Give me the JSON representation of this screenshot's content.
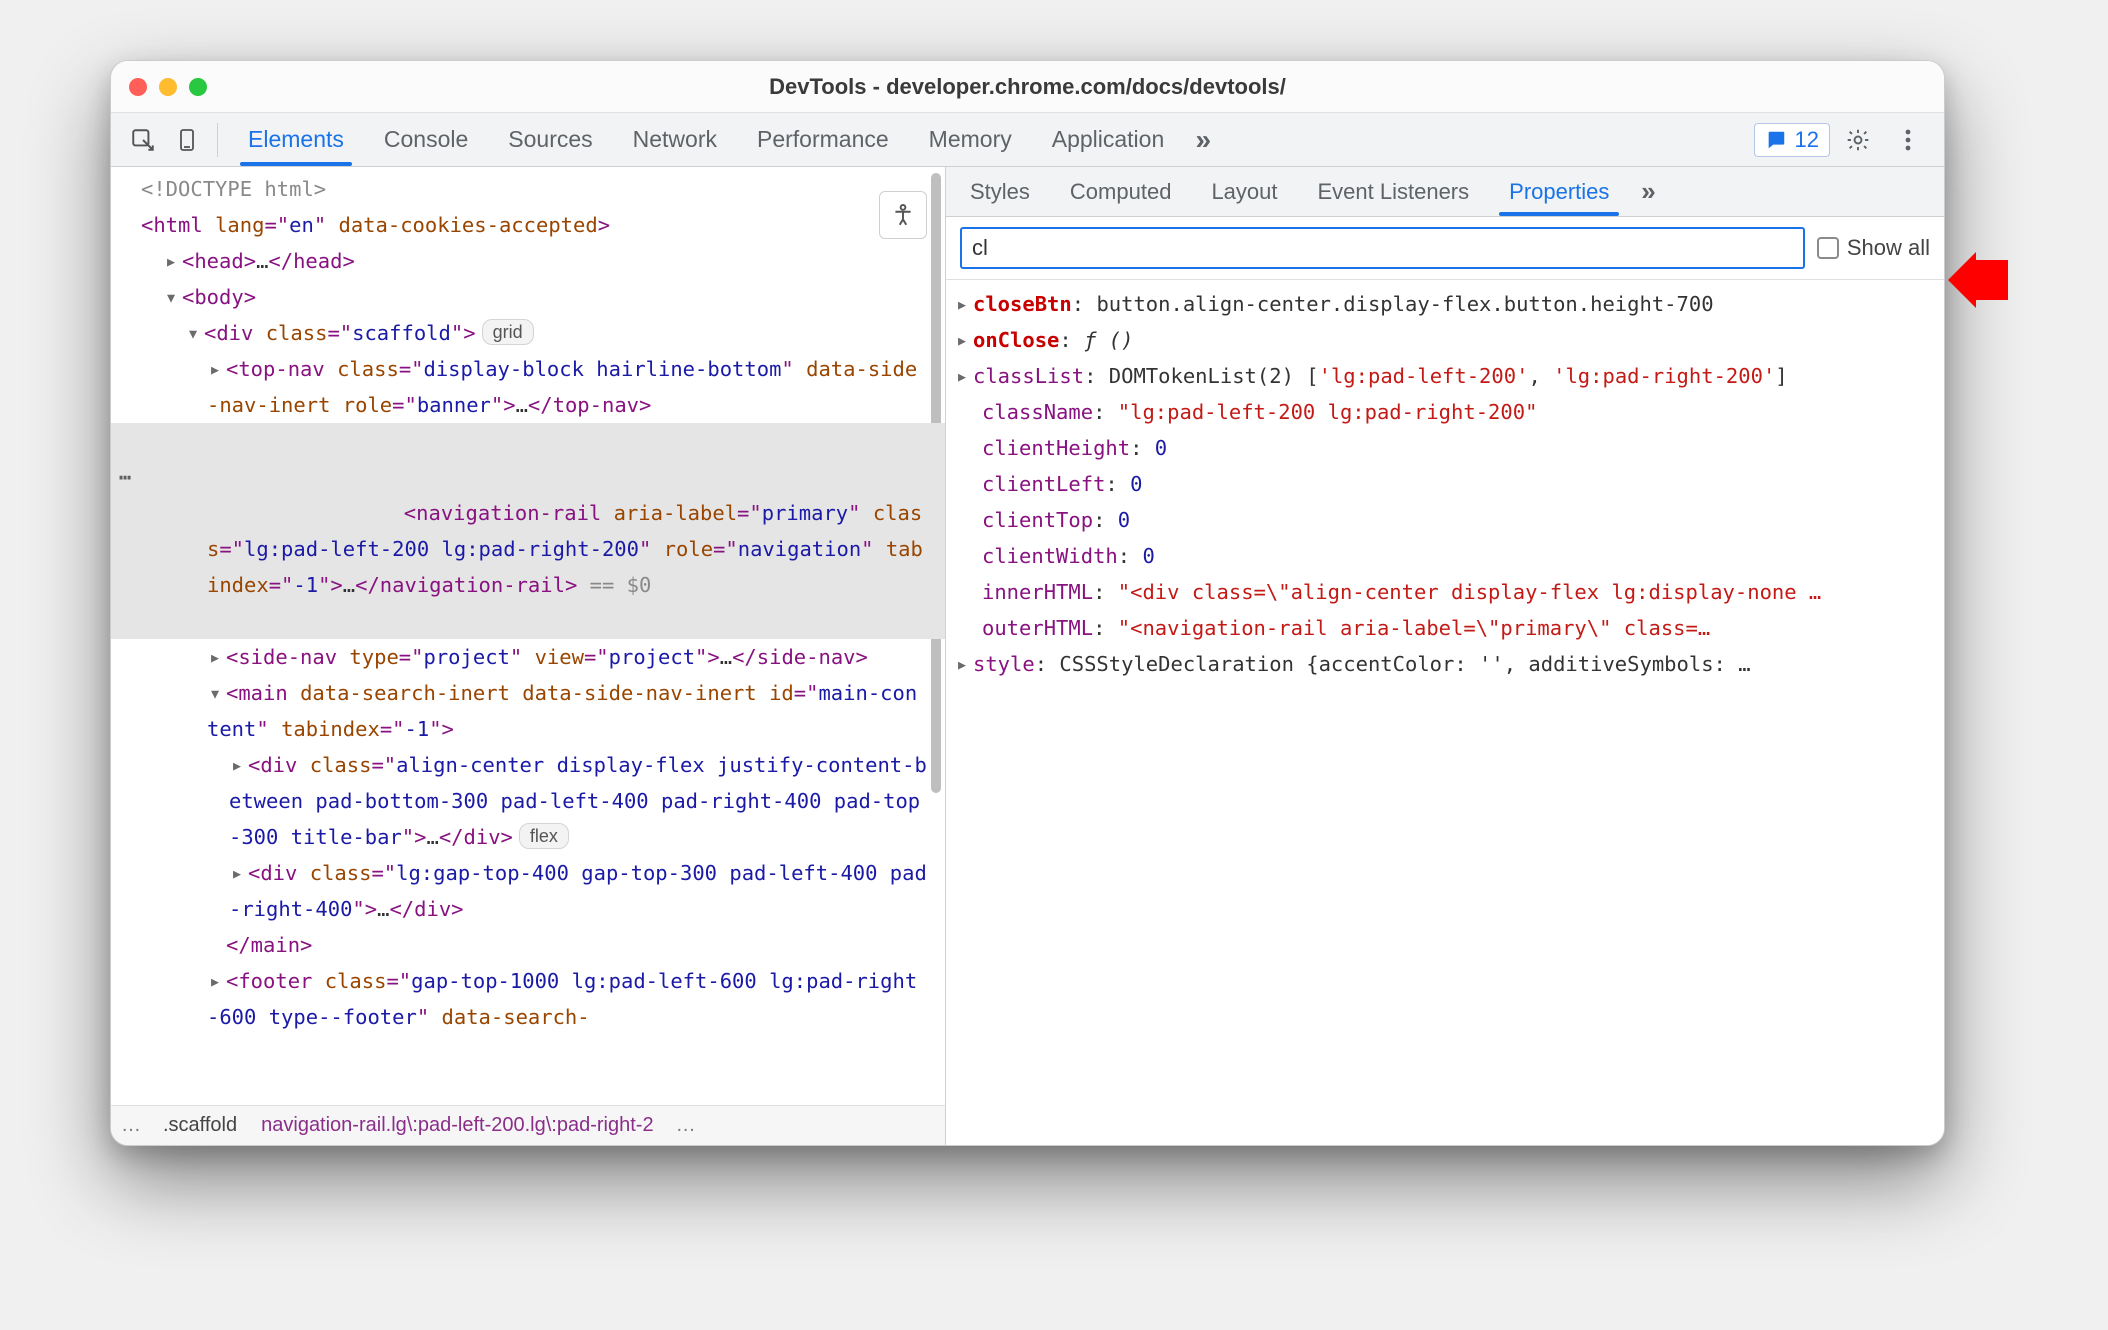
{
  "window": {
    "title": "DevTools - developer.chrome.com/docs/devtools/"
  },
  "issues": {
    "count": "12"
  },
  "mainTabs": {
    "t0": "Elements",
    "t1": "Console",
    "t2": "Sources",
    "t3": "Network",
    "t4": "Performance",
    "t5": "Memory",
    "t6": "Application",
    "overflow": "»"
  },
  "sideTabs": {
    "s0": "Styles",
    "s1": "Computed",
    "s2": "Layout",
    "s3": "Event Listeners",
    "s4": "Properties",
    "overflow": "»"
  },
  "filter": {
    "value": "cl",
    "showAll": "Show all"
  },
  "badges": {
    "grid": "grid",
    "flex": "flex"
  },
  "crumbs": {
    "ell1": "…",
    "scaffold": ".scaffold",
    "nav": "navigation-rail.lg\\:pad-left-200.lg\\:pad-right-2",
    "ell2": "…"
  },
  "tree": {
    "doctype": "<!DOCTYPE html>",
    "htmlOpen1": "<",
    "htmlTag": "html",
    "htmlSp": " ",
    "langAttr": "lang",
    "eq": "=\"",
    "langVal": "en",
    "dq": "\" ",
    "cookiesAttr": "data-cookies-accepted",
    "close": ">",
    "headOpen": "<head>",
    "ell": "…",
    "headClose": "</head>",
    "bodyOpen": "<body>",
    "divOpen": "<div ",
    "classAttr": "class",
    "scaffoldVal": "scaffold",
    "topnavOpen": "<top-nav ",
    "topnavClassVal": "display-block hairline-bottom",
    "dataSideNav": "data-side-nav-inert",
    "roleAttr": "role",
    "bannerVal": "banner",
    "topnavClose": "</top-nav>",
    "navrailOpen": "<navigation-rail ",
    "ariaLabel": "aria-label",
    "primaryVal": "primary",
    "navClassVal": "lg:pad-left-200 lg:pad-right-200",
    "navigVal": "navigation",
    "tabindexAttr": "tabindex",
    "neg1": "-1",
    "navrailClose": "</navigation-rail>",
    "eqSel": " == $0",
    "sidenavOpen": "<side-nav ",
    "typeAttr": "type",
    "projectVal": "project",
    "viewAttr": "view",
    "sidenavClose": "</side-nav>",
    "mainOpen": "<main ",
    "dataSearchAttr": "data-search-inert",
    "idAttr": "id",
    "mainContentVal": "main-content",
    "div2ClassVal": "align-center display-flex justify-content-between pad-bottom-300 pad-left-400 pad-right-400 pad-top-300 title-bar",
    "divClose": "</div>",
    "div3ClassVal": "lg:gap-top-400 gap-top-300 pad-left-400 pad-right-400",
    "mainClose": "</main>",
    "footerOpen": "<footer ",
    "footerClassVal": "gap-top-1000 lg:pad-left-600 lg:pad-right-600 type--footer",
    "dataSearch2": "data-search-"
  },
  "props": {
    "p0k": "closeBtn",
    "p0v": "button.align-center.display-flex.button.height-700",
    "p1k": "onClose",
    "p1v": "ƒ ()",
    "p2k": "classList",
    "p2v_a": "DOMTokenList(2) [",
    "p2v_b": "'lg:pad-left-200'",
    "p2v_c": ", ",
    "p2v_d": "'lg:pad-right-200'",
    "p2v_e": "]",
    "p3k": "className",
    "p3v": "\"lg:pad-left-200 lg:pad-right-200\"",
    "p4k": "clientHeight",
    "p4v": "0",
    "p5k": "clientLeft",
    "p5v": "0",
    "p6k": "clientTop",
    "p6v": "0",
    "p7k": "clientWidth",
    "p7v": "0",
    "p8k": "innerHTML",
    "p8v": "\"<div class=\\\"align-center display-flex lg:display-none …",
    "p9k": "outerHTML",
    "p9v": "\"<navigation-rail aria-label=\\\"primary\\\" class=…",
    "p10k": "style",
    "p10v": "CSSStyleDeclaration {accentColor: '', additiveSymbols: …"
  }
}
